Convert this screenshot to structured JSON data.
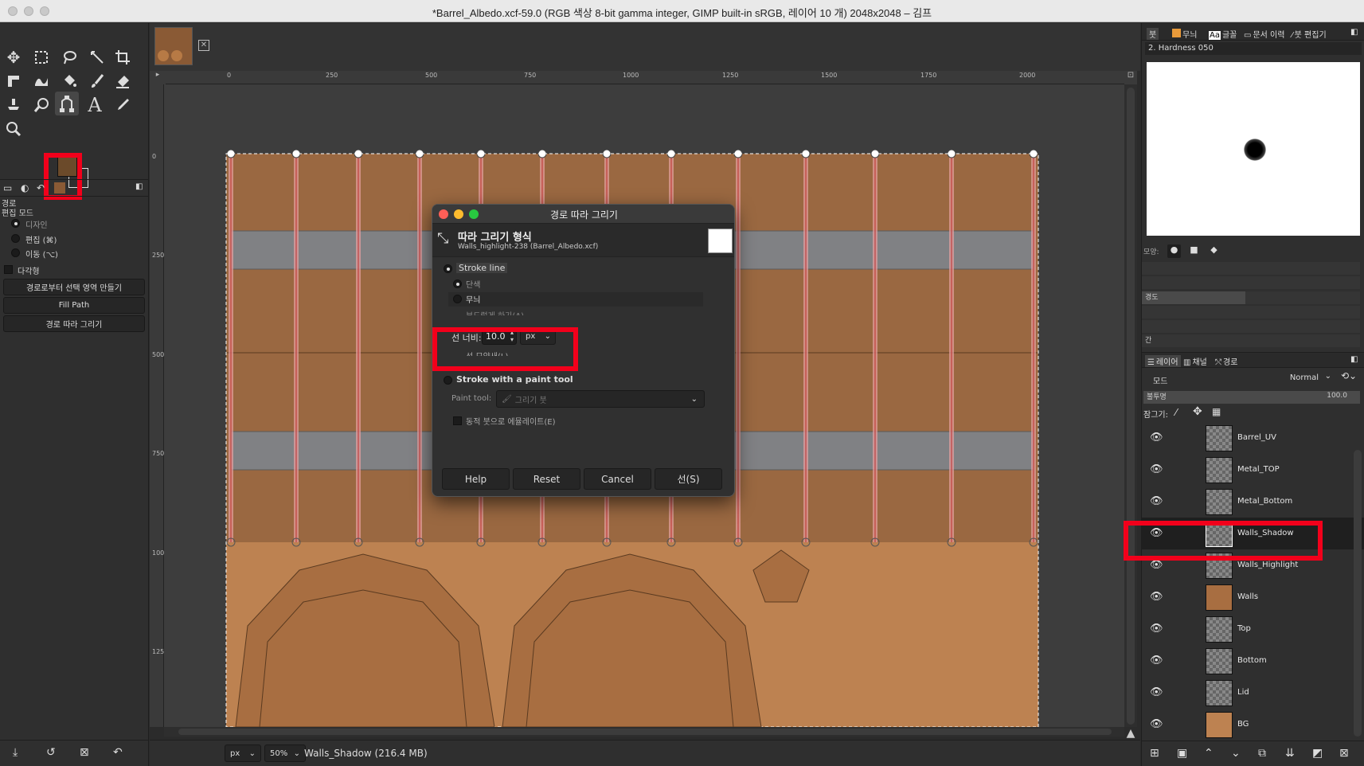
{
  "window": {
    "title": "*Barrel_Albedo.xcf-59.0 (RGB 색상 8-bit gamma integer, GIMP built-in sRGB, 레이어 10 개) 2048x2048 – 김프"
  },
  "ruler": {
    "h_ticks": [
      "0",
      "250",
      "500",
      "750",
      "1000",
      "1250",
      "1500",
      "1750",
      "2000"
    ],
    "v_ticks": [
      "0",
      "250",
      "500",
      "750",
      "1000",
      "1250"
    ]
  },
  "tool_options": {
    "header_title": "경로",
    "edit_mode_label": "편집 모드",
    "modes": [
      {
        "label": "디자인",
        "selected": true
      },
      {
        "label": "편집 (⌘)",
        "selected": false
      },
      {
        "label": "이동 (⌥)",
        "selected": false
      }
    ],
    "polygonal_label": "다각형",
    "buttons": [
      "경로로부터 선택 영역 만들기",
      "Fill Path",
      "경로 따라 그리기"
    ]
  },
  "colors": {
    "foreground": "#6b4a2a",
    "background": "#2f2f2f",
    "highlight": "#f2001b",
    "texture_wood": "#9a6841",
    "texture_metal": "#808184",
    "texture_lower": "#bd8251"
  },
  "status": {
    "unit": "px",
    "zoom": "50%",
    "layer_info": "Walls_Shadow (216.4 MB)"
  },
  "dialog": {
    "title": "경로 따라 그리기",
    "header_title": "따라 그리기 형식",
    "header_subtitle": "Walls_highlight-238 (Barrel_Albedo.xcf)",
    "stroke_line_label": "Stroke line",
    "solid_label": "단색",
    "pattern_label": "무늬",
    "antialias_label": "부드럽게 하기(A)",
    "line_width_label": "선 너비:",
    "line_width_value": "10.0",
    "line_width_unit": "px",
    "line_style_label": "선 모양새(L)",
    "stroke_paint_label": "Stroke with a paint tool",
    "paint_tool_label": "Paint tool:",
    "paint_tool_value": "그리기 붓",
    "emulate_label": "동적 붓으로 에뮬레이트(E)",
    "buttons": {
      "help": "Help",
      "reset": "Reset",
      "cancel": "Cancel",
      "stroke": "선(S)"
    }
  },
  "brush_panel": {
    "tabs": [
      "붓",
      "무늬",
      "글꼴",
      "문서 이력",
      "붓 편집기"
    ],
    "brush_name": "2. Hardness 050",
    "shape_label": "모양:",
    "hardness_label": "경도",
    "spacing_label": "간"
  },
  "layers_panel": {
    "tabs": [
      "레이어",
      "채널",
      "경로"
    ],
    "mode_label": "모드",
    "mode_value": "Normal",
    "opacity_label": "불투명",
    "opacity_value": "100.0",
    "lock_label": "잠그기:",
    "layers": [
      {
        "name": "Barrel_UV",
        "thumb": "checker",
        "selected": false
      },
      {
        "name": "Metal_TOP",
        "thumb": "checker",
        "selected": false
      },
      {
        "name": "Metal_Bottom",
        "thumb": "checker",
        "selected": false
      },
      {
        "name": "Walls_Shadow",
        "thumb": "checker",
        "selected": true
      },
      {
        "name": "Walls_Highlight",
        "thumb": "checker",
        "selected": false
      },
      {
        "name": "Walls",
        "thumb": "brown",
        "selected": false
      },
      {
        "name": "Top",
        "thumb": "checker",
        "selected": false
      },
      {
        "name": "Bottom",
        "thumb": "checker",
        "selected": false
      },
      {
        "name": "Lid",
        "thumb": "checker",
        "selected": false
      },
      {
        "name": "BG",
        "thumb": "brown",
        "selected": false
      }
    ]
  }
}
